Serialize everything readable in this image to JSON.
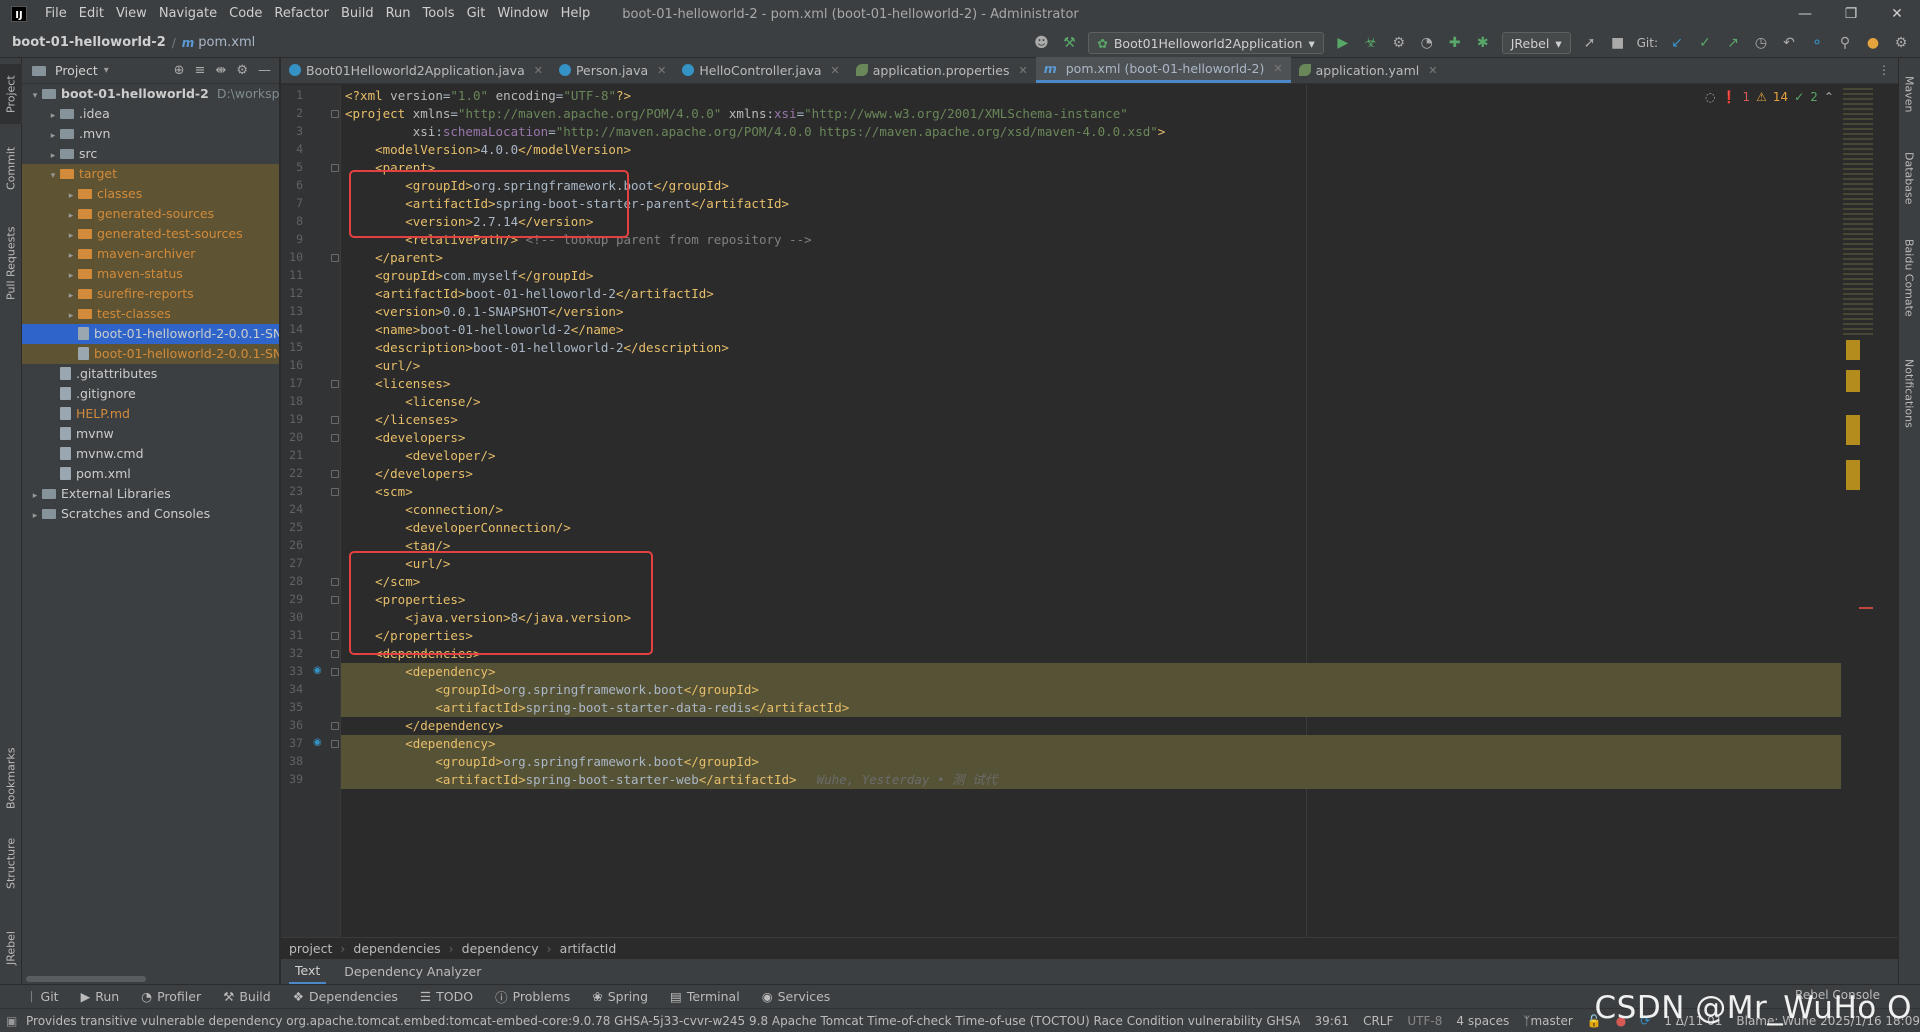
{
  "menubar": {
    "items": [
      "File",
      "Edit",
      "View",
      "Navigate",
      "Code",
      "Refactor",
      "Build",
      "Run",
      "Tools",
      "Git",
      "Window",
      "Help"
    ],
    "title": "boot-01-helloworld-2 - pom.xml (boot-01-helloworld-2) - Administrator"
  },
  "navbar": {
    "project": "boot-01-helloworld-2",
    "file": "pom.xml",
    "run_config": "Boot01Helloworld2Application",
    "jrebel": "JRebel",
    "git_label": "Git:"
  },
  "left_strip": {
    "tabs": [
      "Project",
      "Commit",
      "Pull Requests",
      "Bookmarks",
      "Structure",
      "JRebel"
    ]
  },
  "right_strip": {
    "tabs": [
      "Maven",
      "Database",
      "Baidu Comate",
      "Notifications"
    ]
  },
  "project_panel": {
    "title": "Project",
    "tree": [
      {
        "label": "boot-01-helloworld-2",
        "suffix": "D:\\workspa",
        "indent": 0,
        "type": "folder",
        "expanded": true,
        "bold": true
      },
      {
        "label": ".idea",
        "indent": 1,
        "type": "folder"
      },
      {
        "label": ".mvn",
        "indent": 1,
        "type": "folder"
      },
      {
        "label": "src",
        "indent": 1,
        "type": "folder"
      },
      {
        "label": "target",
        "indent": 1,
        "type": "folder-orange",
        "expanded": true,
        "style": "target"
      },
      {
        "label": "classes",
        "indent": 2,
        "type": "folder-orange",
        "style": "target"
      },
      {
        "label": "generated-sources",
        "indent": 2,
        "type": "folder-orange",
        "style": "target"
      },
      {
        "label": "generated-test-sources",
        "indent": 2,
        "type": "folder-orange",
        "style": "target"
      },
      {
        "label": "maven-archiver",
        "indent": 2,
        "type": "folder-orange",
        "style": "target"
      },
      {
        "label": "maven-status",
        "indent": 2,
        "type": "folder-orange",
        "style": "target"
      },
      {
        "label": "surefire-reports",
        "indent": 2,
        "type": "folder-orange",
        "style": "target"
      },
      {
        "label": "test-classes",
        "indent": 2,
        "type": "folder-orange",
        "style": "target"
      },
      {
        "label": "boot-01-helloworld-2-0.0.1-SN",
        "indent": 2,
        "type": "file",
        "style": "selected",
        "noarrow": true
      },
      {
        "label": "boot-01-helloworld-2-0.0.1-SN",
        "indent": 2,
        "type": "file",
        "style": "target",
        "noarrow": true
      },
      {
        "label": ".gitattributes",
        "indent": 1,
        "type": "file",
        "noarrow": true
      },
      {
        "label": ".gitignore",
        "indent": 1,
        "type": "file",
        "noarrow": true
      },
      {
        "label": "HELP.md",
        "indent": 1,
        "type": "file",
        "noarrow": true,
        "style": "orange"
      },
      {
        "label": "mvnw",
        "indent": 1,
        "type": "file",
        "noarrow": true
      },
      {
        "label": "mvnw.cmd",
        "indent": 1,
        "type": "file",
        "noarrow": true
      },
      {
        "label": "pom.xml",
        "indent": 1,
        "type": "file",
        "noarrow": true
      },
      {
        "label": "External Libraries",
        "indent": 0,
        "type": "folder"
      },
      {
        "label": "Scratches and Consoles",
        "indent": 0,
        "type": "folder"
      }
    ]
  },
  "tabs": [
    {
      "label": "Boot01Helloworld2Application.java",
      "icon": "c"
    },
    {
      "label": "Person.java",
      "icon": "c"
    },
    {
      "label": "HelloController.java",
      "icon": "c"
    },
    {
      "label": "application.properties",
      "icon": "leaf"
    },
    {
      "label": "pom.xml (boot-01-helloworld-2)",
      "icon": "m",
      "active": true
    },
    {
      "label": "application.yaml",
      "icon": "leaf"
    }
  ],
  "inspections": {
    "errors": "1",
    "warnings": "14",
    "ok": "2"
  },
  "code": [
    "<?xml version=\"1.0\" encoding=\"UTF-8\"?>",
    "<project xmlns=\"http://maven.apache.org/POM/4.0.0\" xmlns:xsi=\"http://www.w3.org/2001/XMLSchema-instance\"",
    "         xsi:schemaLocation=\"http://maven.apache.org/POM/4.0.0 https://maven.apache.org/xsd/maven-4.0.0.xsd\">",
    "    <modelVersion>4.0.0</modelVersion>",
    "    <parent>",
    "        <groupId>org.springframework.boot</groupId>",
    "        <artifactId>spring-boot-starter-parent</artifactId>",
    "        <version>2.7.14</version>",
    "        <relativePath/> <!-- lookup parent from repository -->",
    "    </parent>",
    "    <groupId>com.myself</groupId>",
    "    <artifactId>boot-01-helloworld-2</artifactId>",
    "    <version>0.0.1-SNAPSHOT</version>",
    "    <name>boot-01-helloworld-2</name>",
    "    <description>boot-01-helloworld-2</description>",
    "    <url/>",
    "    <licenses>",
    "        <license/>",
    "    </licenses>",
    "    <developers>",
    "        <developer/>",
    "    </developers>",
    "    <scm>",
    "        <connection/>",
    "        <developerConnection/>",
    "        <tag/>",
    "        <url/>",
    "    </scm>",
    "    <properties>",
    "        <java.version>8</java.version>",
    "    </properties>",
    "    <dependencies>",
    "        <dependency>",
    "            <groupId>org.springframework.boot</groupId>",
    "            <artifactId>spring-boot-starter-data-redis</artifactId>",
    "        </dependency>",
    "        <dependency>",
    "            <groupId>org.springframework.boot</groupId>",
    "            <artifactId>spring-boot-starter-web</artifactId>"
  ],
  "inlay_hint": "Wuhe, Yesterday • 测 试代",
  "editor_breadcrumbs": [
    "project",
    "dependencies",
    "dependency",
    "artifactId"
  ],
  "editor_subtabs": [
    "Text",
    "Dependency Analyzer"
  ],
  "toolwindows": [
    "Git",
    "Run",
    "Profiler",
    "Build",
    "Dependencies",
    "TODO",
    "Problems",
    "Spring",
    "Terminal",
    "Services"
  ],
  "rebel_console": "Rebel Console",
  "status": {
    "message": "Provides transitive vulnerable dependency org.apache.tomcat.embed:tomcat-embed-core:9.0.78 GHSA-5j33-cvvr-w245 9.8 Apache Tomcat Time-of-check Time-of-use (TOCTOU) Race Condition vulnerability GHSA-wm...",
    "position": "39:61",
    "line_sep": "CRLF",
    "encoding": "UTF-8",
    "indent": "4 spaces",
    "branch": "master",
    "vcs": "1 Δ/11 01",
    "blame": "Blame: Wuhe 2025/1/16 18:09"
  },
  "watermark": "CSDN @Mr_WuHo O"
}
